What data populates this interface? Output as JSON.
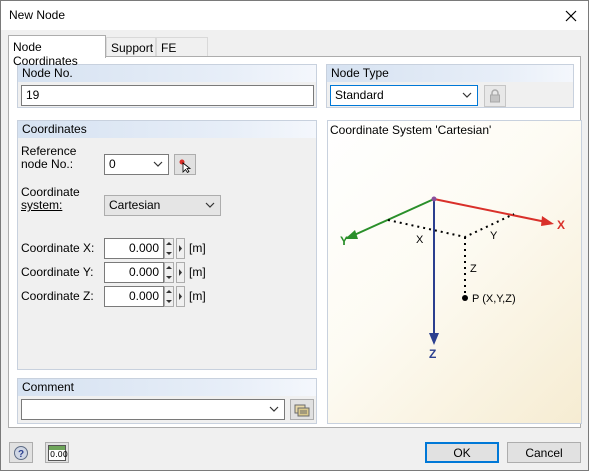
{
  "window": {
    "title": "New Node"
  },
  "tabs": [
    {
      "label": "Node Coordinates"
    },
    {
      "label": "Support"
    },
    {
      "label": "FE Mesh"
    }
  ],
  "node_no": {
    "label": "Node No.",
    "value": "19"
  },
  "node_type": {
    "label": "Node Type",
    "value": "Standard"
  },
  "coordinates": {
    "label": "Coordinates",
    "reference_label_1": "Reference",
    "reference_label_2": "node No.:",
    "reference_value": "0",
    "system_label_1": "Coordinate",
    "system_label_2": "system:",
    "system_value": "Cartesian",
    "rows": [
      {
        "label": "Coordinate X:",
        "value": "0.000",
        "unit": "[m]"
      },
      {
        "label": "Coordinate Y:",
        "value": "0.000",
        "unit": "[m]"
      },
      {
        "label": "Coordinate Z:",
        "value": "0.000",
        "unit": "[m]"
      }
    ]
  },
  "comment": {
    "label": "Comment",
    "value": ""
  },
  "diagram": {
    "title": "Coordinate System 'Cartesian'",
    "axis_x": "X",
    "axis_y": "Y",
    "axis_z": "Z",
    "dist_x": "X",
    "dist_y": "Y",
    "dist_z": "Z",
    "point": "P (X,Y,Z)",
    "colors": {
      "x": "#d9302a",
      "y": "#2a8f2a",
      "z": "#2b3f8f"
    }
  },
  "footer": {
    "units_icon_text": "0.00",
    "ok_label": "OK",
    "cancel_label": "Cancel"
  }
}
